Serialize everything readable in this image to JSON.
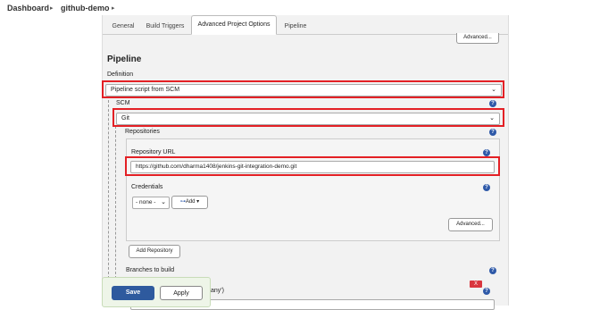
{
  "breadcrumb": {
    "items": [
      "Dashboard",
      "github-demo"
    ],
    "separator": "▸"
  },
  "tabs": [
    {
      "label": "General",
      "active": false
    },
    {
      "label": "Build Triggers",
      "active": false
    },
    {
      "label": "Advanced Project Options",
      "active": true
    },
    {
      "label": "Pipeline",
      "active": false
    }
  ],
  "top_advanced_label": "Advanced...",
  "pipeline": {
    "heading": "Pipeline",
    "definition_label": "Definition",
    "definition_value": "Pipeline script from SCM",
    "scm_label": "SCM",
    "scm_value": "Git",
    "repositories_label": "Repositories",
    "repository_url_label": "Repository URL",
    "repository_url_value": "https://github.com/dharma1408/jenkins-git-integration-demo.git",
    "credentials_label": "Credentials",
    "credentials_value": "- none -",
    "add_label": "Add",
    "advanced_label": "Advanced...",
    "add_repository_label": "Add Repository",
    "branches_label": "Branches to build",
    "partial_text": "any')",
    "x_label": "X"
  },
  "actions": {
    "save_label": "Save",
    "apply_label": "Apply"
  },
  "colors": {
    "highlight": "#e32025",
    "help": "#2e59a8",
    "save": "#2e5a9e",
    "remove": "#d9363e"
  },
  "icons": [
    "chevron-right-icon",
    "help-icon",
    "chevron-down-icon",
    "key-icon"
  ]
}
